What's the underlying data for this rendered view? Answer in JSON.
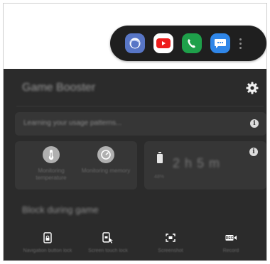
{
  "dock": {
    "apps": [
      {
        "name": "Samsung Internet",
        "icon": "internet-icon",
        "color": "#5876c6"
      },
      {
        "name": "YouTube",
        "icon": "youtube-icon",
        "color": "#ee1c1b"
      },
      {
        "name": "Phone",
        "icon": "phone-icon",
        "color": "#1ea04a"
      },
      {
        "name": "Messages",
        "icon": "messages-icon",
        "color": "#2f86e8"
      }
    ]
  },
  "booster": {
    "title": "Game Booster",
    "learning_text": "Learning your usage patterns...",
    "monitor": [
      {
        "label": "Monitoring temperature",
        "icon": "thermometer-icon"
      },
      {
        "label": "Monitoring memory",
        "icon": "gauge-icon"
      }
    ],
    "battery": {
      "time": "2 h 5 m",
      "label": "48%",
      "icon": "battery-icon"
    },
    "block_title": "Block during game",
    "actions": [
      {
        "label": "Navigation button lock",
        "icon": "navigation-lock-icon"
      },
      {
        "label": "Screen touch lock",
        "icon": "touch-lock-icon"
      },
      {
        "label": "Screenshot",
        "icon": "screenshot-icon"
      },
      {
        "label": "Record",
        "icon": "record-icon"
      }
    ]
  },
  "colors": {
    "panel_bg": "#2b2b2b",
    "card_bg": "#363636",
    "dock_bg": "#1f1f1f"
  }
}
